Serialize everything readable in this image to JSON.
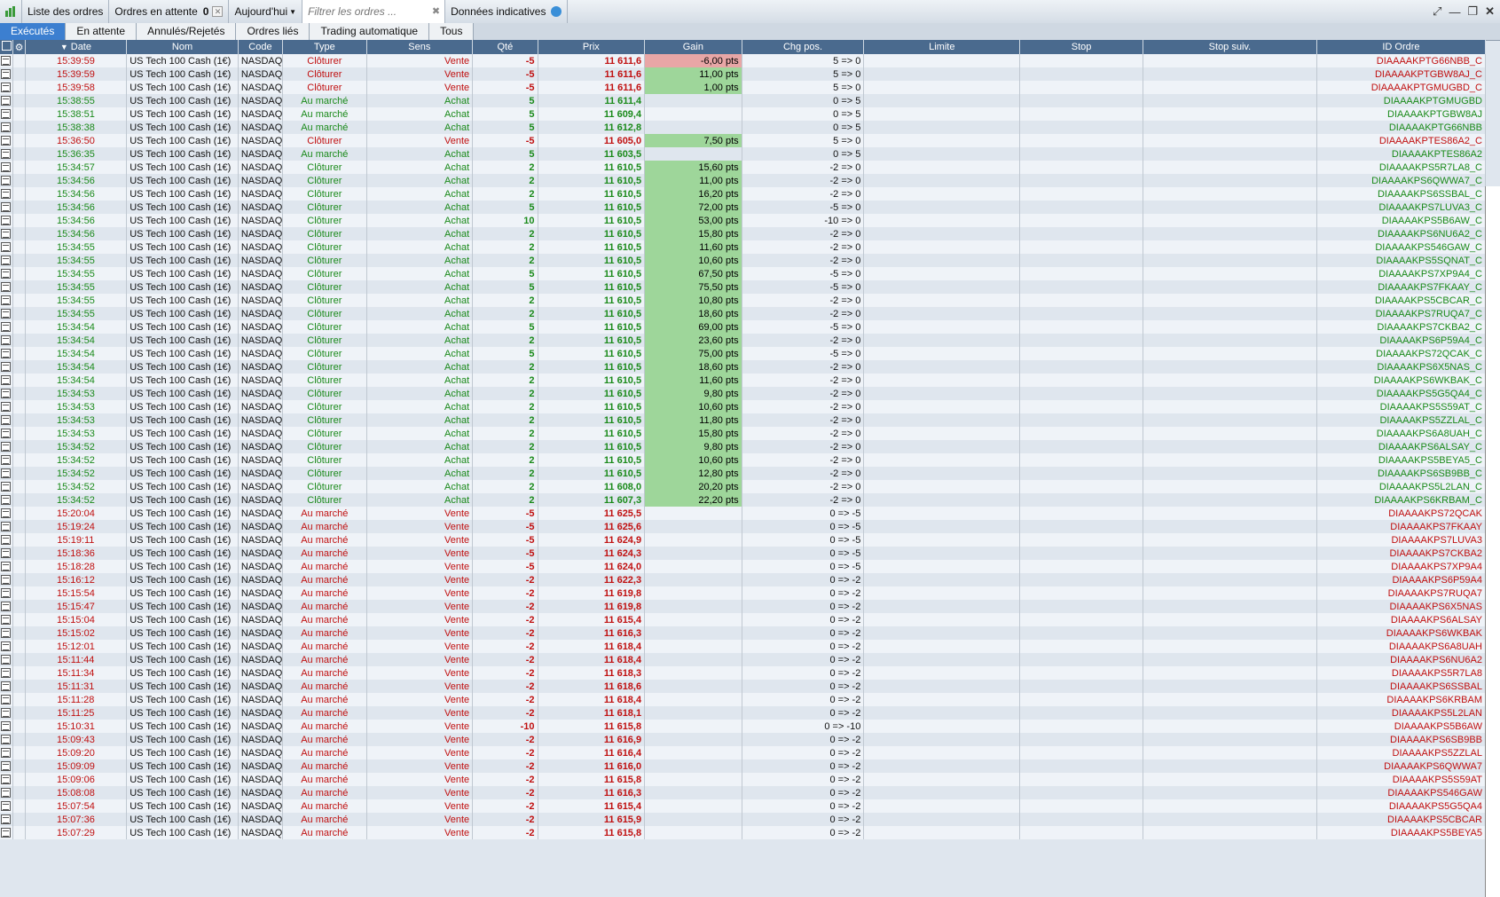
{
  "toolbar": {
    "orders_list": "Liste des ordres",
    "pending_label": "Ordres en attente",
    "pending_count": "0",
    "period": "Aujourd'hui",
    "filter_placeholder": "Filtrer les ordres ...",
    "indicative": "Données indicatives"
  },
  "tabs": [
    "Exécutés",
    "En attente",
    "Annulés/Rejetés",
    "Ordres liés",
    "Trading automatique",
    "Tous"
  ],
  "columns": [
    "Date",
    "Nom",
    "Code",
    "Type",
    "Sens",
    "Qté",
    "Prix",
    "Gain",
    "Chg pos.",
    "Limite",
    "Stop",
    "Stop suiv.",
    "ID Ordre"
  ],
  "rows": [
    [
      "15:39:59",
      "US Tech 100 Cash (1€)",
      "NASDAQ",
      "Clôturer",
      "Vente",
      "-5",
      "11 611,6",
      "-6,00 pts",
      "5 => 0",
      "DIAAAAKPTG66NBB_C"
    ],
    [
      "15:39:59",
      "US Tech 100 Cash (1€)",
      "NASDAQ",
      "Clôturer",
      "Vente",
      "-5",
      "11 611,6",
      "11,00 pts",
      "5 => 0",
      "DIAAAAKPTGBW8AJ_C"
    ],
    [
      "15:39:58",
      "US Tech 100 Cash (1€)",
      "NASDAQ",
      "Clôturer",
      "Vente",
      "-5",
      "11 611,6",
      "1,00 pts",
      "5 => 0",
      "DIAAAAKPTGMUGBD_C"
    ],
    [
      "15:38:55",
      "US Tech 100 Cash (1€)",
      "NASDAQ",
      "Au marché",
      "Achat",
      "5",
      "11 611,4",
      "",
      "0 => 5",
      "DIAAAAKPTGMUGBD"
    ],
    [
      "15:38:51",
      "US Tech 100 Cash (1€)",
      "NASDAQ",
      "Au marché",
      "Achat",
      "5",
      "11 609,4",
      "",
      "0 => 5",
      "DIAAAAKPTGBW8AJ"
    ],
    [
      "15:38:38",
      "US Tech 100 Cash (1€)",
      "NASDAQ",
      "Au marché",
      "Achat",
      "5",
      "11 612,8",
      "",
      "0 => 5",
      "DIAAAAKPTG66NBB"
    ],
    [
      "15:36:50",
      "US Tech 100 Cash (1€)",
      "NASDAQ",
      "Clôturer",
      "Vente",
      "-5",
      "11 605,0",
      "7,50 pts",
      "5 => 0",
      "DIAAAAKPTES86A2_C"
    ],
    [
      "15:36:35",
      "US Tech 100 Cash (1€)",
      "NASDAQ",
      "Au marché",
      "Achat",
      "5",
      "11 603,5",
      "",
      "0 => 5",
      "DIAAAAKPTES86A2"
    ],
    [
      "15:34:57",
      "US Tech 100 Cash (1€)",
      "NASDAQ",
      "Clôturer",
      "Achat",
      "2",
      "11 610,5",
      "15,60 pts",
      "-2 => 0",
      "DIAAAAKPS5R7LA8_C"
    ],
    [
      "15:34:56",
      "US Tech 100 Cash (1€)",
      "NASDAQ",
      "Clôturer",
      "Achat",
      "2",
      "11 610,5",
      "11,00 pts",
      "-2 => 0",
      "DIAAAAKPS6QWWA7_C"
    ],
    [
      "15:34:56",
      "US Tech 100 Cash (1€)",
      "NASDAQ",
      "Clôturer",
      "Achat",
      "2",
      "11 610,5",
      "16,20 pts",
      "-2 => 0",
      "DIAAAAKPS6SSBAL_C"
    ],
    [
      "15:34:56",
      "US Tech 100 Cash (1€)",
      "NASDAQ",
      "Clôturer",
      "Achat",
      "5",
      "11 610,5",
      "72,00 pts",
      "-5 => 0",
      "DIAAAAKPS7LUVA3_C"
    ],
    [
      "15:34:56",
      "US Tech 100 Cash (1€)",
      "NASDAQ",
      "Clôturer",
      "Achat",
      "10",
      "11 610,5",
      "53,00 pts",
      "-10 => 0",
      "DIAAAAKPS5B6AW_C"
    ],
    [
      "15:34:56",
      "US Tech 100 Cash (1€)",
      "NASDAQ",
      "Clôturer",
      "Achat",
      "2",
      "11 610,5",
      "15,80 pts",
      "-2 => 0",
      "DIAAAAKPS6NU6A2_C"
    ],
    [
      "15:34:55",
      "US Tech 100 Cash (1€)",
      "NASDAQ",
      "Clôturer",
      "Achat",
      "2",
      "11 610,5",
      "11,60 pts",
      "-2 => 0",
      "DIAAAAKPS546GAW_C"
    ],
    [
      "15:34:55",
      "US Tech 100 Cash (1€)",
      "NASDAQ",
      "Clôturer",
      "Achat",
      "2",
      "11 610,5",
      "10,60 pts",
      "-2 => 0",
      "DIAAAAKPS5SQNAT_C"
    ],
    [
      "15:34:55",
      "US Tech 100 Cash (1€)",
      "NASDAQ",
      "Clôturer",
      "Achat",
      "5",
      "11 610,5",
      "67,50 pts",
      "-5 => 0",
      "DIAAAAKPS7XP9A4_C"
    ],
    [
      "15:34:55",
      "US Tech 100 Cash (1€)",
      "NASDAQ",
      "Clôturer",
      "Achat",
      "5",
      "11 610,5",
      "75,50 pts",
      "-5 => 0",
      "DIAAAAKPS7FKAAY_C"
    ],
    [
      "15:34:55",
      "US Tech 100 Cash (1€)",
      "NASDAQ",
      "Clôturer",
      "Achat",
      "2",
      "11 610,5",
      "10,80 pts",
      "-2 => 0",
      "DIAAAAKPS5CBCAR_C"
    ],
    [
      "15:34:55",
      "US Tech 100 Cash (1€)",
      "NASDAQ",
      "Clôturer",
      "Achat",
      "2",
      "11 610,5",
      "18,60 pts",
      "-2 => 0",
      "DIAAAAKPS7RUQA7_C"
    ],
    [
      "15:34:54",
      "US Tech 100 Cash (1€)",
      "NASDAQ",
      "Clôturer",
      "Achat",
      "5",
      "11 610,5",
      "69,00 pts",
      "-5 => 0",
      "DIAAAAKPS7CKBA2_C"
    ],
    [
      "15:34:54",
      "US Tech 100 Cash (1€)",
      "NASDAQ",
      "Clôturer",
      "Achat",
      "2",
      "11 610,5",
      "23,60 pts",
      "-2 => 0",
      "DIAAAAKPS6P59A4_C"
    ],
    [
      "15:34:54",
      "US Tech 100 Cash (1€)",
      "NASDAQ",
      "Clôturer",
      "Achat",
      "5",
      "11 610,5",
      "75,00 pts",
      "-5 => 0",
      "DIAAAAKPS72QCAK_C"
    ],
    [
      "15:34:54",
      "US Tech 100 Cash (1€)",
      "NASDAQ",
      "Clôturer",
      "Achat",
      "2",
      "11 610,5",
      "18,60 pts",
      "-2 => 0",
      "DIAAAAKPS6X5NAS_C"
    ],
    [
      "15:34:54",
      "US Tech 100 Cash (1€)",
      "NASDAQ",
      "Clôturer",
      "Achat",
      "2",
      "11 610,5",
      "11,60 pts",
      "-2 => 0",
      "DIAAAAKPS6WKBAK_C"
    ],
    [
      "15:34:53",
      "US Tech 100 Cash (1€)",
      "NASDAQ",
      "Clôturer",
      "Achat",
      "2",
      "11 610,5",
      "9,80 pts",
      "-2 => 0",
      "DIAAAAKPS5G5QA4_C"
    ],
    [
      "15:34:53",
      "US Tech 100 Cash (1€)",
      "NASDAQ",
      "Clôturer",
      "Achat",
      "2",
      "11 610,5",
      "10,60 pts",
      "-2 => 0",
      "DIAAAAKPS5S59AT_C"
    ],
    [
      "15:34:53",
      "US Tech 100 Cash (1€)",
      "NASDAQ",
      "Clôturer",
      "Achat",
      "2",
      "11 610,5",
      "11,80 pts",
      "-2 => 0",
      "DIAAAAKPS5ZZLAL_C"
    ],
    [
      "15:34:53",
      "US Tech 100 Cash (1€)",
      "NASDAQ",
      "Clôturer",
      "Achat",
      "2",
      "11 610,5",
      "15,80 pts",
      "-2 => 0",
      "DIAAAAKPS6A8UAH_C"
    ],
    [
      "15:34:52",
      "US Tech 100 Cash (1€)",
      "NASDAQ",
      "Clôturer",
      "Achat",
      "2",
      "11 610,5",
      "9,80 pts",
      "-2 => 0",
      "DIAAAAKPS6ALSAY_C"
    ],
    [
      "15:34:52",
      "US Tech 100 Cash (1€)",
      "NASDAQ",
      "Clôturer",
      "Achat",
      "2",
      "11 610,5",
      "10,60 pts",
      "-2 => 0",
      "DIAAAAKPS5BEYA5_C"
    ],
    [
      "15:34:52",
      "US Tech 100 Cash (1€)",
      "NASDAQ",
      "Clôturer",
      "Achat",
      "2",
      "11 610,5",
      "12,80 pts",
      "-2 => 0",
      "DIAAAAKPS6SB9BB_C"
    ],
    [
      "15:34:52",
      "US Tech 100 Cash (1€)",
      "NASDAQ",
      "Clôturer",
      "Achat",
      "2",
      "11 608,0",
      "20,20 pts",
      "-2 => 0",
      "DIAAAAKPS5L2LAN_C"
    ],
    [
      "15:34:52",
      "US Tech 100 Cash (1€)",
      "NASDAQ",
      "Clôturer",
      "Achat",
      "2",
      "11 607,3",
      "22,20 pts",
      "-2 => 0",
      "DIAAAAKPS6KRBAM_C"
    ],
    [
      "15:20:04",
      "US Tech 100 Cash (1€)",
      "NASDAQ",
      "Au marché",
      "Vente",
      "-5",
      "11 625,5",
      "",
      "0 => -5",
      "DIAAAAKPS72QCAK"
    ],
    [
      "15:19:24",
      "US Tech 100 Cash (1€)",
      "NASDAQ",
      "Au marché",
      "Vente",
      "-5",
      "11 625,6",
      "",
      "0 => -5",
      "DIAAAAKPS7FKAAY"
    ],
    [
      "15:19:11",
      "US Tech 100 Cash (1€)",
      "NASDAQ",
      "Au marché",
      "Vente",
      "-5",
      "11 624,9",
      "",
      "0 => -5",
      "DIAAAAKPS7LUVA3"
    ],
    [
      "15:18:36",
      "US Tech 100 Cash (1€)",
      "NASDAQ",
      "Au marché",
      "Vente",
      "-5",
      "11 624,3",
      "",
      "0 => -5",
      "DIAAAAKPS7CKBA2"
    ],
    [
      "15:18:28",
      "US Tech 100 Cash (1€)",
      "NASDAQ",
      "Au marché",
      "Vente",
      "-5",
      "11 624,0",
      "",
      "0 => -5",
      "DIAAAAKPS7XP9A4"
    ],
    [
      "15:16:12",
      "US Tech 100 Cash (1€)",
      "NASDAQ",
      "Au marché",
      "Vente",
      "-2",
      "11 622,3",
      "",
      "0 => -2",
      "DIAAAAKPS6P59A4"
    ],
    [
      "15:15:54",
      "US Tech 100 Cash (1€)",
      "NASDAQ",
      "Au marché",
      "Vente",
      "-2",
      "11 619,8",
      "",
      "0 => -2",
      "DIAAAAKPS7RUQA7"
    ],
    [
      "15:15:47",
      "US Tech 100 Cash (1€)",
      "NASDAQ",
      "Au marché",
      "Vente",
      "-2",
      "11 619,8",
      "",
      "0 => -2",
      "DIAAAAKPS6X5NAS"
    ],
    [
      "15:15:04",
      "US Tech 100 Cash (1€)",
      "NASDAQ",
      "Au marché",
      "Vente",
      "-2",
      "11 615,4",
      "",
      "0 => -2",
      "DIAAAAKPS6ALSAY"
    ],
    [
      "15:15:02",
      "US Tech 100 Cash (1€)",
      "NASDAQ",
      "Au marché",
      "Vente",
      "-2",
      "11 616,3",
      "",
      "0 => -2",
      "DIAAAAKPS6WKBAK"
    ],
    [
      "15:12:01",
      "US Tech 100 Cash (1€)",
      "NASDAQ",
      "Au marché",
      "Vente",
      "-2",
      "11 618,4",
      "",
      "0 => -2",
      "DIAAAAKPS6A8UAH"
    ],
    [
      "15:11:44",
      "US Tech 100 Cash (1€)",
      "NASDAQ",
      "Au marché",
      "Vente",
      "-2",
      "11 618,4",
      "",
      "0 => -2",
      "DIAAAAKPS6NU6A2"
    ],
    [
      "15:11:34",
      "US Tech 100 Cash (1€)",
      "NASDAQ",
      "Au marché",
      "Vente",
      "-2",
      "11 618,3",
      "",
      "0 => -2",
      "DIAAAAKPS5R7LA8"
    ],
    [
      "15:11:31",
      "US Tech 100 Cash (1€)",
      "NASDAQ",
      "Au marché",
      "Vente",
      "-2",
      "11 618,6",
      "",
      "0 => -2",
      "DIAAAAKPS6SSBAL"
    ],
    [
      "15:11:28",
      "US Tech 100 Cash (1€)",
      "NASDAQ",
      "Au marché",
      "Vente",
      "-2",
      "11 618,4",
      "",
      "0 => -2",
      "DIAAAAKPS6KRBAM"
    ],
    [
      "15:11:25",
      "US Tech 100 Cash (1€)",
      "NASDAQ",
      "Au marché",
      "Vente",
      "-2",
      "11 618,1",
      "",
      "0 => -2",
      "DIAAAAKPS5L2LAN"
    ],
    [
      "15:10:31",
      "US Tech 100 Cash (1€)",
      "NASDAQ",
      "Au marché",
      "Vente",
      "-10",
      "11 615,8",
      "",
      "0 => -10",
      "DIAAAAKPS5B6AW"
    ],
    [
      "15:09:43",
      "US Tech 100 Cash (1€)",
      "NASDAQ",
      "Au marché",
      "Vente",
      "-2",
      "11 616,9",
      "",
      "0 => -2",
      "DIAAAAKPS6SB9BB"
    ],
    [
      "15:09:20",
      "US Tech 100 Cash (1€)",
      "NASDAQ",
      "Au marché",
      "Vente",
      "-2",
      "11 616,4",
      "",
      "0 => -2",
      "DIAAAAKPS5ZZLAL"
    ],
    [
      "15:09:09",
      "US Tech 100 Cash (1€)",
      "NASDAQ",
      "Au marché",
      "Vente",
      "-2",
      "11 616,0",
      "",
      "0 => -2",
      "DIAAAAKPS6QWWA7"
    ],
    [
      "15:09:06",
      "US Tech 100 Cash (1€)",
      "NASDAQ",
      "Au marché",
      "Vente",
      "-2",
      "11 615,8",
      "",
      "0 => -2",
      "DIAAAAKPS5S59AT"
    ],
    [
      "15:08:08",
      "US Tech 100 Cash (1€)",
      "NASDAQ",
      "Au marché",
      "Vente",
      "-2",
      "11 616,3",
      "",
      "0 => -2",
      "DIAAAAKPS546GAW"
    ],
    [
      "15:07:54",
      "US Tech 100 Cash (1€)",
      "NASDAQ",
      "Au marché",
      "Vente",
      "-2",
      "11 615,4",
      "",
      "0 => -2",
      "DIAAAAKPS5G5QA4"
    ],
    [
      "15:07:36",
      "US Tech 100 Cash (1€)",
      "NASDAQ",
      "Au marché",
      "Vente",
      "-2",
      "11 615,9",
      "",
      "0 => -2",
      "DIAAAAKPS5CBCAR"
    ],
    [
      "15:07:29",
      "US Tech 100 Cash (1€)",
      "NASDAQ",
      "Au marché",
      "Vente",
      "-2",
      "11 615,8",
      "",
      "0 => -2",
      "DIAAAAKPS5BEYA5"
    ]
  ],
  "colors": {
    "buy": "#1a8a1a",
    "sell": "#c01010",
    "gain_positive_bg": "#9ed69a",
    "gain_negative_bg": "#e8a6a6",
    "header_bg": "#4a6a8e",
    "active_tab": "#3c7fd0"
  }
}
